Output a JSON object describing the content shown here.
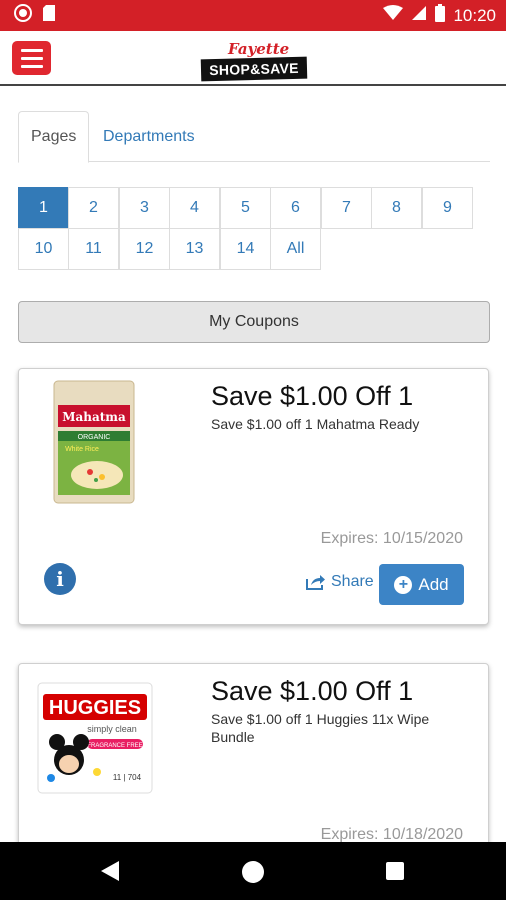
{
  "status_bar": {
    "time": "10:20"
  },
  "header": {
    "logo_top": "Fayette",
    "logo_main": "SHOP&SAVE"
  },
  "tabs": {
    "pages": "Pages",
    "departments": "Departments"
  },
  "pagination": {
    "pages": [
      "1",
      "2",
      "3",
      "4",
      "5",
      "6",
      "7",
      "8",
      "9",
      "10",
      "11",
      "12",
      "13",
      "14",
      "All"
    ],
    "active": "1"
  },
  "my_coupons_label": "My Coupons",
  "coupons": [
    {
      "title": "Save $1.00 Off 1",
      "description": "Save $1.00 off 1 Mahatma Ready",
      "expires": "Expires: 10/15/2020",
      "share_label": "Share",
      "add_label": "Add",
      "image_brand": "Mahatma",
      "image_line1": "ORGANIC",
      "image_line2": "White Rice"
    },
    {
      "title": "Save $1.00 Off 1",
      "description": "Save $1.00 off 1 Huggies 11x Wipe Bundle",
      "expires": "Expires: 10/18/2020",
      "image_brand": "HUGGIES",
      "image_line1": "simply clean",
      "image_line2": "FRAGRANCE FREE"
    }
  ],
  "colors": {
    "status_red": "#d32027",
    "link_blue": "#337ab7",
    "add_blue": "#3c84c6"
  }
}
